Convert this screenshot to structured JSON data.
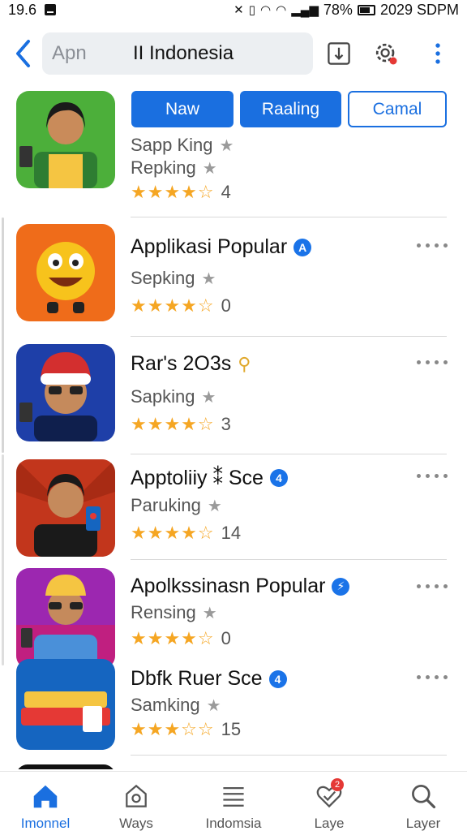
{
  "status_bar": {
    "time": "19.6",
    "battery": "78%",
    "clock": "2029 SDPM"
  },
  "app_bar": {
    "search_placeholder": "Apn",
    "search_value": "II Indonesia"
  },
  "filters": {
    "now": "Naw",
    "rating": "Raaling",
    "casual": "Camal"
  },
  "apps": [
    {
      "title": "",
      "sub1": "Sapp King",
      "sub2": "Repking",
      "stars": "★★★★☆",
      "count": "4"
    },
    {
      "title": "Applikasi Popular",
      "badge": "A",
      "sub1": "Sepking",
      "stars": "★★★★☆",
      "count": "0"
    },
    {
      "title": "Rar's 2O3s",
      "sub1": "Sapking",
      "stars": "★★★★☆",
      "count": "3"
    },
    {
      "title": "Apptoliiy ⁑ Sce",
      "badge": "4",
      "sub1": "Paruking",
      "stars": "★★★★☆",
      "count": "14"
    },
    {
      "title": "Apolkssinasn Popular",
      "badge": "⚡",
      "sub1": "Rensing",
      "stars": "★★★★☆",
      "count": "0"
    },
    {
      "title": "Dbfk Ruer Sce",
      "badge": "4",
      "sub1": "Samking",
      "stars": "★★★☆☆",
      "count": "15"
    }
  ],
  "bottom_nav": [
    {
      "label": "Imonnel",
      "icon": "home-icon",
      "active": true
    },
    {
      "label": "Ways",
      "icon": "ways-icon"
    },
    {
      "label": "Indomsia",
      "icon": "list-icon"
    },
    {
      "label": "Laye",
      "icon": "heart-icon",
      "badge": "2"
    },
    {
      "label": "Layer",
      "icon": "search-icon"
    }
  ],
  "colors": {
    "accent": "#1a6fe0",
    "star": "#f5a623",
    "badge_red": "#e53935"
  }
}
